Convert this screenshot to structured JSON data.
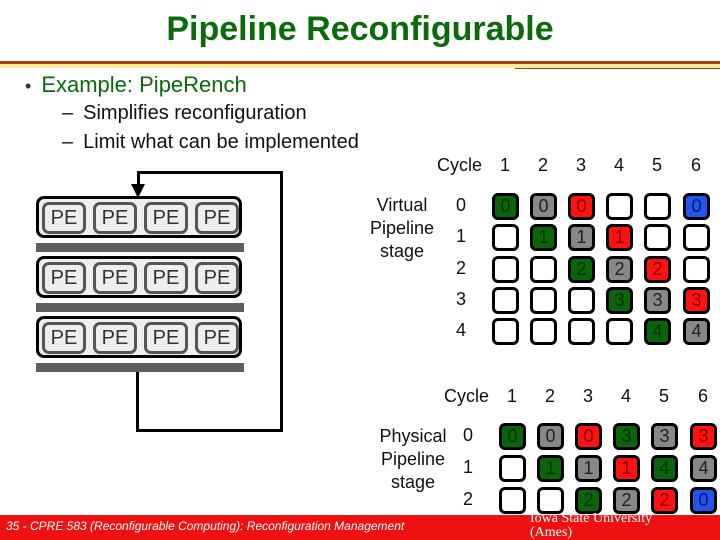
{
  "slide": {
    "title": "Pipeline Reconfigurable",
    "bullet": "Example: PipeRench",
    "subbullets": [
      "Simplifies reconfiguration",
      "Limit what can be implemented"
    ]
  },
  "pe_array": {
    "label": "PE",
    "rows": 3,
    "cols": 4
  },
  "colors": {
    "green": "#0a640a",
    "gray": "#888888",
    "red": "#ff1111",
    "blue": "#2255ee",
    "green_text": "#033003",
    "gray_text": "#222222",
    "red_text": "#7a0000",
    "blue_text": "#0a1a66"
  },
  "virtual_table": {
    "cycle_label": "Cycle",
    "cycles": [
      "1",
      "2",
      "3",
      "4",
      "5",
      "6"
    ],
    "row_label": [
      "Virtual",
      "Pipeline",
      "stage"
    ],
    "stages": [
      "0",
      "1",
      "2",
      "3",
      "4"
    ],
    "cells": [
      [
        {
          "c": "green",
          "t": "0"
        },
        {
          "c": "gray",
          "t": "0"
        },
        {
          "c": "red",
          "t": "0"
        },
        null,
        null,
        {
          "c": "blue",
          "t": "0"
        }
      ],
      [
        null,
        {
          "c": "green",
          "t": "1"
        },
        {
          "c": "gray",
          "t": "1"
        },
        {
          "c": "red",
          "t": "1"
        },
        null,
        null
      ],
      [
        null,
        null,
        {
          "c": "green",
          "t": "2"
        },
        {
          "c": "gray",
          "t": "2"
        },
        {
          "c": "red",
          "t": "2"
        },
        null
      ],
      [
        null,
        null,
        null,
        {
          "c": "green",
          "t": "3"
        },
        {
          "c": "gray",
          "t": "3"
        },
        {
          "c": "red",
          "t": "3"
        }
      ],
      [
        null,
        null,
        null,
        null,
        {
          "c": "green",
          "t": "4"
        },
        {
          "c": "gray",
          "t": "4"
        }
      ]
    ]
  },
  "physical_table": {
    "cycle_label": "Cycle",
    "cycles": [
      "1",
      "2",
      "3",
      "4",
      "5",
      "6"
    ],
    "row_label": [
      "Physical",
      "Pipeline",
      "stage"
    ],
    "stages": [
      "0",
      "1",
      "2"
    ],
    "cells": [
      [
        {
          "c": "green",
          "t": "0"
        },
        {
          "c": "gray",
          "t": "0"
        },
        {
          "c": "red",
          "t": "0"
        },
        {
          "c": "green",
          "t": "3"
        },
        {
          "c": "gray",
          "t": "3"
        },
        {
          "c": "red",
          "t": "3"
        }
      ],
      [
        null,
        {
          "c": "green",
          "t": "1"
        },
        {
          "c": "gray",
          "t": "1"
        },
        {
          "c": "red",
          "t": "1"
        },
        {
          "c": "green",
          "t": "4"
        },
        {
          "c": "gray",
          "t": "4"
        }
      ],
      [
        null,
        null,
        {
          "c": "green",
          "t": "2"
        },
        {
          "c": "gray",
          "t": "2"
        },
        {
          "c": "red",
          "t": "2"
        },
        {
          "c": "blue",
          "t": "0"
        }
      ]
    ]
  },
  "footer": {
    "left": "35 - CPRE 583 (Reconfigurable Computing): Reconfiguration Management",
    "right_line1": "Iowa State University",
    "right_line2": "(Ames)"
  }
}
